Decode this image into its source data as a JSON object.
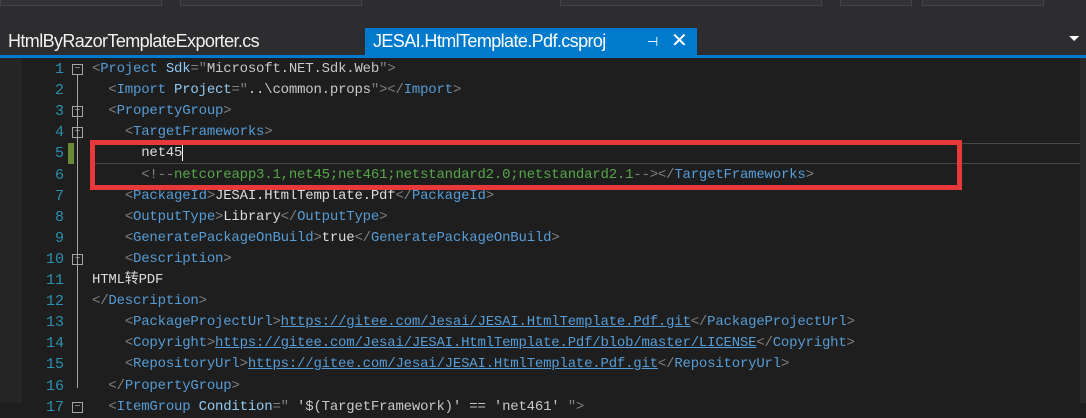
{
  "tabs": [
    {
      "label": "HtmlByRazorTemplateExporter.cs",
      "active": false
    },
    {
      "label": "JESAI.HtmlTemplate.Pdf.csproj",
      "active": true
    }
  ],
  "tab_icons": {
    "pin": "pin-icon",
    "close": "close-icon",
    "overflow": "dropdown-icon"
  },
  "editor": {
    "current_line": 5,
    "lines": [
      {
        "n": "1",
        "fold": "open",
        "tokens": [
          [
            "punct",
            "<"
          ],
          [
            "tag",
            "Project"
          ],
          [
            "attr",
            " Sdk"
          ],
          [
            "punct",
            "=\""
          ],
          [
            "val",
            "Microsoft.NET.Sdk.Web"
          ],
          [
            "punct",
            "\">"
          ]
        ]
      },
      {
        "n": "2",
        "tokens": [
          [
            "text",
            "  "
          ],
          [
            "punct",
            "<"
          ],
          [
            "tag",
            "Import"
          ],
          [
            "attr",
            " Project"
          ],
          [
            "punct",
            "=\""
          ],
          [
            "val",
            "..\\common.props"
          ],
          [
            "punct",
            "\"></"
          ],
          [
            "tag",
            "Import"
          ],
          [
            "punct",
            ">"
          ]
        ]
      },
      {
        "n": "3",
        "fold": "open",
        "tokens": [
          [
            "text",
            "  "
          ],
          [
            "punct",
            "<"
          ],
          [
            "tag",
            "PropertyGroup"
          ],
          [
            "punct",
            ">"
          ]
        ]
      },
      {
        "n": "4",
        "fold": "open",
        "tokens": [
          [
            "text",
            "    "
          ],
          [
            "punct",
            "<"
          ],
          [
            "tag",
            "TargetFrameworks"
          ],
          [
            "punct",
            ">"
          ]
        ]
      },
      {
        "n": "5",
        "tokens": [
          [
            "text",
            "      net45"
          ]
        ]
      },
      {
        "n": "6",
        "tokens": [
          [
            "text",
            "      "
          ],
          [
            "punct",
            "<!--"
          ],
          [
            "comment",
            "netcoreapp3.1,net45;net461;netstandard2.0;netstandard2.1"
          ],
          [
            "punct",
            "--></"
          ],
          [
            "tag",
            "TargetFrameworks"
          ],
          [
            "punct",
            ">"
          ]
        ]
      },
      {
        "n": "7",
        "tokens": [
          [
            "text",
            "    "
          ],
          [
            "punct",
            "<"
          ],
          [
            "tag",
            "PackageId"
          ],
          [
            "punct",
            ">"
          ],
          [
            "text",
            "JESAI.HtmlTemplate.Pdf"
          ],
          [
            "punct",
            "</"
          ],
          [
            "tag",
            "PackageId"
          ],
          [
            "punct",
            ">"
          ]
        ]
      },
      {
        "n": "8",
        "tokens": [
          [
            "text",
            "    "
          ],
          [
            "punct",
            "<"
          ],
          [
            "tag",
            "OutputType"
          ],
          [
            "punct",
            ">"
          ],
          [
            "text",
            "Library"
          ],
          [
            "punct",
            "</"
          ],
          [
            "tag",
            "OutputType"
          ],
          [
            "punct",
            ">"
          ]
        ]
      },
      {
        "n": "9",
        "tokens": [
          [
            "text",
            "    "
          ],
          [
            "punct",
            "<"
          ],
          [
            "tag",
            "GeneratePackageOnBuild"
          ],
          [
            "punct",
            ">"
          ],
          [
            "text",
            "true"
          ],
          [
            "punct",
            "</"
          ],
          [
            "tag",
            "GeneratePackageOnBuild"
          ],
          [
            "punct",
            ">"
          ]
        ]
      },
      {
        "n": "10",
        "fold": "open",
        "tokens": [
          [
            "text",
            "    "
          ],
          [
            "punct",
            "<"
          ],
          [
            "tag",
            "Description"
          ],
          [
            "punct",
            ">"
          ]
        ]
      },
      {
        "n": "11",
        "tokens": [
          [
            "text",
            "HTML转PDF"
          ]
        ]
      },
      {
        "n": "12",
        "tokens": [
          [
            "punct",
            "</"
          ],
          [
            "tag",
            "Description"
          ],
          [
            "punct",
            ">"
          ]
        ]
      },
      {
        "n": "13",
        "tokens": [
          [
            "text",
            "    "
          ],
          [
            "punct",
            "<"
          ],
          [
            "tag",
            "PackageProjectUrl"
          ],
          [
            "punct",
            ">"
          ],
          [
            "link",
            "https://gitee.com/Jesai/JESAI.HtmlTemplate.Pdf.git"
          ],
          [
            "punct",
            "</"
          ],
          [
            "tag",
            "PackageProjectUrl"
          ],
          [
            "punct",
            ">"
          ]
        ]
      },
      {
        "n": "14",
        "tokens": [
          [
            "text",
            "    "
          ],
          [
            "punct",
            "<"
          ],
          [
            "tag",
            "Copyright"
          ],
          [
            "punct",
            ">"
          ],
          [
            "link",
            "https://gitee.com/Jesai/JESAI.HtmlTemplate.Pdf/blob/master/LICENSE"
          ],
          [
            "punct",
            "</"
          ],
          [
            "tag",
            "Copyright"
          ],
          [
            "punct",
            ">"
          ]
        ]
      },
      {
        "n": "15",
        "tokens": [
          [
            "text",
            "    "
          ],
          [
            "punct",
            "<"
          ],
          [
            "tag",
            "RepositoryUrl"
          ],
          [
            "punct",
            ">"
          ],
          [
            "link",
            "https://gitee.com/Jesai/JESAI.HtmlTemplate.Pdf.git"
          ],
          [
            "punct",
            "</"
          ],
          [
            "tag",
            "RepositoryUrl"
          ],
          [
            "punct",
            ">"
          ]
        ]
      },
      {
        "n": "16",
        "tokens": [
          [
            "text",
            "  "
          ],
          [
            "punct",
            "</"
          ],
          [
            "tag",
            "PropertyGroup"
          ],
          [
            "punct",
            ">"
          ]
        ]
      },
      {
        "n": "17",
        "fold": "open",
        "tokens": [
          [
            "text",
            "  "
          ],
          [
            "punct",
            "<"
          ],
          [
            "tag",
            "ItemGroup"
          ],
          [
            "attr",
            " Condition"
          ],
          [
            "punct",
            "=\""
          ],
          [
            "val",
            " '$(TargetFramework)' == 'net461' "
          ],
          [
            "punct",
            "\">"
          ]
        ]
      }
    ]
  }
}
